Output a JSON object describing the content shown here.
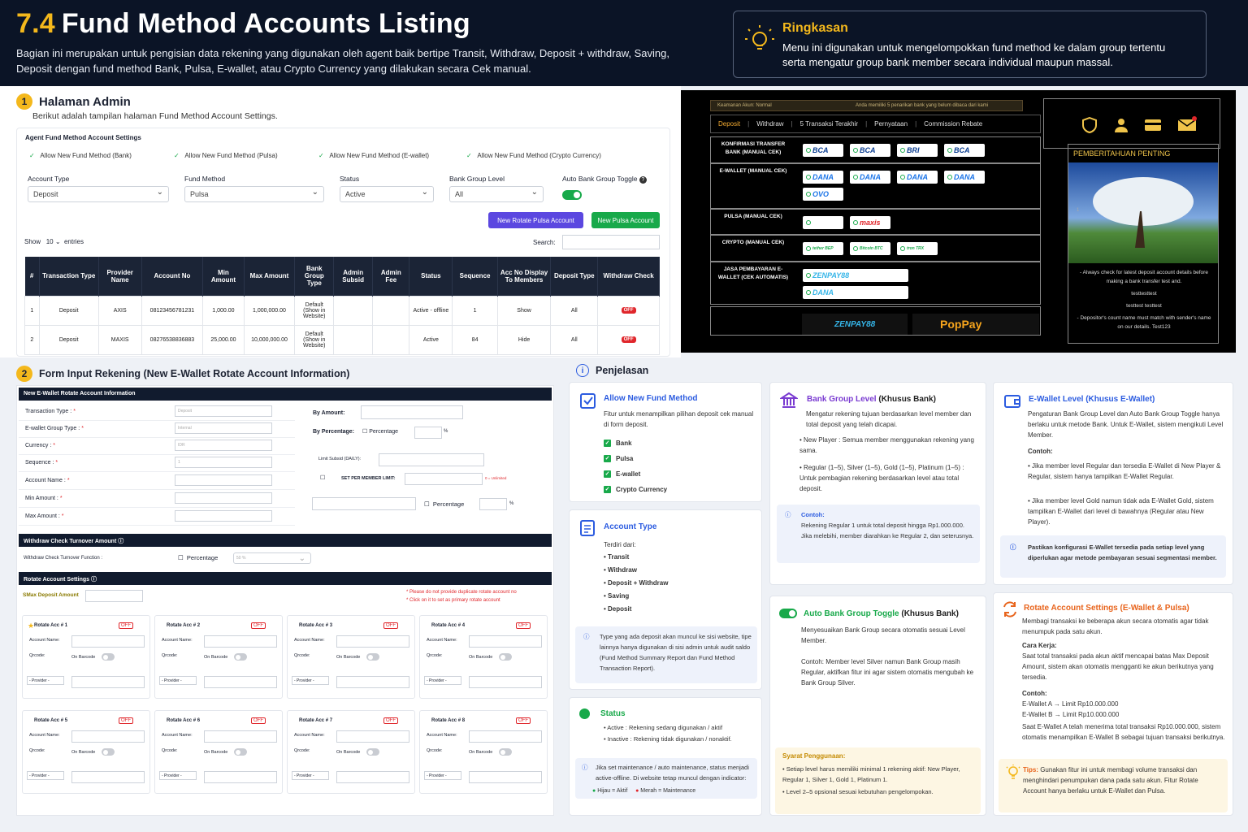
{
  "header": {
    "num": "7.4",
    "title": "Fund Method Accounts Listing",
    "desc": "Bagian ini merupakan untuk pengisian data rekening yang digunakan oleh agent baik bertipe Transit, Withdraw, Deposit + withdraw, Saving, Deposit dengan fund method Bank, Pulsa, E-wallet, atau Crypto Currency yang dilakukan secara Cek manual.",
    "summary_title": "Ringkasan",
    "summary_text": "Menu ini digunakan untuk mengelompokkan fund method ke dalam group tertentu serta mengatur group bank member secara individual maupun massal."
  },
  "s1": {
    "num": "1",
    "title": "Halaman Admin",
    "sub": "Berikut adalah tampilan halaman Fund Method Account Settings.",
    "panel_title": "Agent Fund Method Account Settings",
    "allow": [
      "Allow New Fund Method (Bank)",
      "Allow New Fund Method (Pulsa)",
      "Allow New Fund Method (E-wallet)",
      "Allow New Fund Method (Crypto Currency)"
    ],
    "f_account_type": "Account Type",
    "v_account_type": "Deposit",
    "f_fund": "Fund Method",
    "v_fund": "Pulsa",
    "f_status": "Status",
    "v_status": "Active",
    "f_bgl": "Bank Group Level",
    "v_bgl": "All",
    "f_auto": "Auto Bank Group Toggle",
    "btn_rotate": "New Rotate Pulsa Account",
    "btn_pulsa": "New Pulsa Account",
    "show": "Show",
    "show_n": "10",
    "entries": "entries",
    "search": "Search:",
    "cols": [
      "#",
      "Transaction Type",
      "Provider Name",
      "Account No",
      "Min Amount",
      "Max Amount",
      "Bank Group Type",
      "Admin Subsid",
      "Admin Fee",
      "Status",
      "Sequence",
      "Acc No Display To Members",
      "Deposit Type",
      "Withdraw Check"
    ],
    "rows": [
      [
        "1",
        "Deposit",
        "AXIS",
        "08123456781231",
        "1,000.00",
        "1,000,000.00",
        "Default (Show in Website)",
        "",
        "",
        "Active - offline",
        "1",
        "Show",
        "All",
        "OFF"
      ],
      [
        "2",
        "Deposit",
        "MAXIS",
        "08276538836883",
        "25,000.00",
        "10,000,000.00",
        "Default (Show in Website)",
        "",
        "",
        "Active",
        "84",
        "Hide",
        "All",
        "OFF"
      ]
    ]
  },
  "member": {
    "topbar_left": "Keamanan Akun: Normal",
    "topbar_right": "Anda memiliki 5 penarikan bank yang belum dibaca dari kami",
    "tabs": [
      "Deposit",
      "Withdraw",
      "5 Transaksi Terakhir",
      "Pernyataan",
      "Commission Rebate"
    ],
    "groups": [
      {
        "label": "KONFIRMASI TRANSFER BANK (MANUAL CEK)",
        "items": [
          "BCA",
          "BCA",
          "BRI",
          "BCA"
        ]
      },
      {
        "label": "E-WALLET (MANUAL CEK)",
        "items": [
          "DANA",
          "DANA",
          "DANA",
          "DANA",
          "OVO"
        ]
      },
      {
        "label": "PULSA (MANUAL CEK)",
        "items": [
          "",
          "maxis"
        ]
      },
      {
        "label": "CRYPTO (MANUAL CEK)",
        "items": [
          "tether BEP",
          "Bitcoin BTC",
          "tron TRX"
        ]
      },
      {
        "label": "JASA PEMBAYARAN E-WALLET (CEK AUTOMATIS)",
        "items": [
          "ZENPAY88",
          "DANA"
        ]
      }
    ],
    "bottom": [
      "ZENPAY88",
      "PopPay"
    ],
    "notice_title": "PEMBERITAHUAN PENTING",
    "notice_num": "1",
    "notice_lines": [
      "- Always check for latest deposit account details before making a bank transfer test and.",
      "testtesttest",
      "testtest testtest",
      "- Depositor's count name must match with sender's name on our details. Test123"
    ]
  },
  "s2": {
    "num": "2",
    "title": "Form Input Rekening (New E-Wallet Rotate Account Information)",
    "form_title": "New E-Wallet Rotate Account Information",
    "fields": [
      "Transaction Type :",
      "E-wallet Group Type :",
      "Currency :",
      "Sequence :",
      "Account Name :",
      "Min Amount :",
      "Max Amount :"
    ],
    "ph": [
      "Deposit",
      "Internal",
      "IDR",
      "1"
    ],
    "by_amount": "By Amount:",
    "by_pct": "By Percentage:",
    "pct": "Percentage",
    "limit": "Limit Subsid (DAILY):",
    "set_limit": "SET PER MEMBER LIMIT:",
    "unlimited": "0 = Unlimited",
    "pct2": "Percentage",
    "wct_title": "Withdraw Check Turnover Amount",
    "wct_func": "Withdraw Check Turnover Function :",
    "wct_pct": "Percentage",
    "wct_v": "50 %",
    "ras_title": "Rotate Account Settings",
    "smax": "SMax Deposit Amount",
    "warn1": "* Please do not provide duplicate rotate account no",
    "warn2": "* Click on it to set as primary rotate account",
    "accs": [
      "Rotate Acc # 1",
      "Rotate Acc # 2",
      "Rotate Acc # 3",
      "Rotate Acc # 4",
      "Rotate Acc # 5",
      "Rotate Acc # 6",
      "Rotate Acc # 7",
      "Rotate Acc # 8"
    ],
    "acc_name": "Account Name:",
    "qrcode": "Qrcode:",
    "barcode": "On Barcode",
    "provider": "- Provider -",
    "off": "OFF"
  },
  "pj": {
    "title": "Penjelasan",
    "c1_title": "Allow New Fund Method",
    "c1_text": "Fitur untuk menampilkan pilihan deposit cek manual di form deposit.",
    "c1_items": [
      "Bank",
      "Pulsa",
      "E-wallet",
      "Crypto Currency"
    ],
    "c2_title": "Account Type",
    "c2_text": "Terdiri dari:",
    "c2_items": [
      "Transit",
      "Withdraw",
      "Deposit + Withdraw",
      "Saving",
      "Deposit"
    ],
    "c2_note": "Type yang ada deposit akan muncul ke sisi website, tipe lainnya hanya digunakan di sisi admin untuk audit saldo (Fund Method Summary Report dan Fund Method Transaction Report).",
    "c3_title": "Status",
    "c3_items": [
      "Active   :  Rekening sedang digunakan / aktif",
      "Inactive  :  Rekening tidak digunakan / nonaktif."
    ],
    "c3_note": "Jika set maintenance / auto maintenance, status menjadi active-offline. Di website tetap muncul dengan indicator:",
    "c3_green": "Hijau = Aktif",
    "c3_red": "Merah = Maintenance",
    "c4_title": "Bank Group Level",
    "c4_sub": "(Khusus Bank)",
    "c4_text": "Mengatur rekening tujuan berdasarkan level member dan total deposit yang telah dicapai.",
    "c4_b1": "New Player  :  Semua member menggunakan rekening yang sama.",
    "c4_b2": "Regular (1–5), Silver (1–5), Gold (1–5), Platinum (1–5)  :  Untuk pembagian rekening berdasarkan level atau total deposit.",
    "c4_contoh": "Contoh:",
    "c4_ex": "Rekening Regular 1 untuk total deposit hingga Rp1.000.000. Jika melebihi, member diarahkan ke Regular 2, dan seterusnya.",
    "c5_title": "Auto Bank Group Toggle",
    "c5_sub": "(Khusus Bank)",
    "c5_text": "Menyesuaikan Bank Group secara otomatis sesuai Level Member.",
    "c5_ex": "Contoh: Member level Silver namun Bank Group masih Regular, aktifkan fitur ini agar sistem otomatis mengubah ke Bank Group Silver.",
    "c5_syarat": "Syarat Penggunaan:",
    "c5_s1": "Setiap level harus memiliki minimal 1 rekening aktif: New Player, Regular 1, Silver 1, Gold 1, Platinum 1.",
    "c5_s2": "Level 2–5 opsional sesuai kebutuhan pengelompokan.",
    "c6_title": "E-Wallet Level (Khusus E-Wallet)",
    "c6_text": "Pengaturan Bank Group Level dan Auto Bank Group Toggle hanya berlaku untuk metode Bank. Untuk E-Wallet, sistem mengikuti Level Member.",
    "c6_contoh": "Contoh:",
    "c6_b1": "Jika member level Regular dan tersedia E-Wallet di New Player & Regular, sistem hanya tampilkan E-Wallet Regular.",
    "c6_b2": "Jika member level Gold namun tidak ada E-Wallet Gold, sistem tampilkan E-Wallet dari level di bawahnya (Regular atau New Player).",
    "c6_note": "Pastikan konfigurasi E-Wallet tersedia pada setiap level yang diperlukan agar metode pembayaran sesuai segmentasi member.",
    "c7_title": "Rotate Account Settings (E-Wallet & Pulsa)",
    "c7_text": "Membagi transaksi ke beberapa akun secara otomatis agar tidak menumpuk pada satu akun.",
    "c7_cara": "Cara Kerja:",
    "c7_cara_t": "Saat total transaksi pada akun aktif mencapai batas Max Deposit Amount, sistem akan otomatis mengganti ke akun berikutnya yang tersedia.",
    "c7_contoh": "Contoh:",
    "c7_a": "E-Wallet A → Limit Rp10.000.000",
    "c7_b": "E-Wallet B → Limit Rp10.000.000",
    "c7_ex": "Saat E-Wallet A telah menerima total transaksi Rp10.000.000, sistem otomatis menampilkan E-Wallet B sebagai tujuan transaksi berikutnya.",
    "c7_tips": "Tips:",
    "c7_tips_t": "Gunakan fitur ini untuk membagi volume transaksi dan menghindari penumpukan dana pada satu akun. Fitur Rotate Account hanya berlaku untuk E-Wallet dan Pulsa."
  }
}
